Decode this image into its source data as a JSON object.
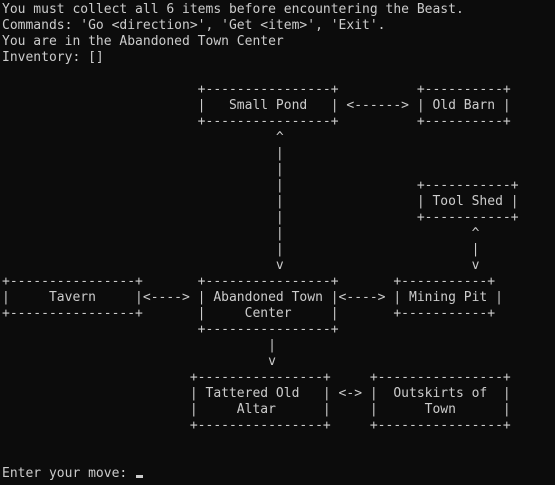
{
  "intro": {
    "line1": "You must collect all 6 items before encountering the Beast.",
    "line2": "Commands: 'Go <direction>', 'Get <item>', 'Exit'.",
    "location": "You are in the Abandoned Town Center",
    "inventory": "Inventory: []"
  },
  "map": [
    "                         +----------------+          +----------+",
    "                         |   Small Pond   | <------> | Old Barn |",
    "                         +----------------+          +----------+",
    "                                   ^",
    "                                   |",
    "                                   |",
    "                                   |                 +-----------+",
    "                                   |                 | Tool Shed |",
    "                                   |                 +-----------+",
    "                                   |                        ^",
    "                                   |                        |",
    "                                   v                        v",
    "+----------------+       +----------------+       +-----------+",
    "|     Tavern     |<----> | Abandoned Town |<----> | Mining Pit |",
    "+----------------+       |     Center     |       +-----------+",
    "                         +----------------+",
    "                                  |",
    "                                  v",
    "                        +----------------+     +----------------+",
    "                        | Tattered Old   | <-> |  Outskirts of  |",
    "                        |     Altar      |     |      Town      |",
    "                        +----------------+     +----------------+"
  ],
  "prompt": {
    "text": "Enter your move: "
  }
}
